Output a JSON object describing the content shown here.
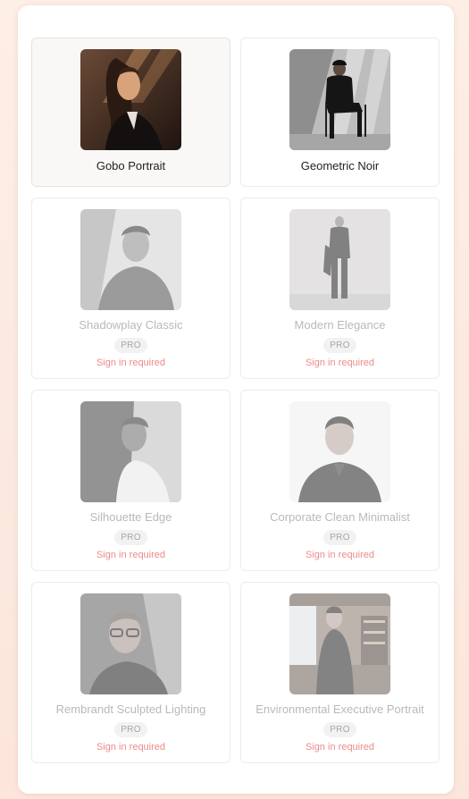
{
  "styles": [
    {
      "name": "Gobo Portrait",
      "pro": false,
      "selected": true,
      "icon": "portrait-woman-shadow-thumbnail"
    },
    {
      "name": "Geometric Noir",
      "pro": false,
      "selected": false,
      "icon": "portrait-man-chair-thumbnail"
    },
    {
      "name": "Shadowplay Classic",
      "pro": true,
      "badge": "PRO",
      "notice": "Sign in required",
      "icon": "portrait-man-sweater-thumbnail"
    },
    {
      "name": "Modern Elegance",
      "pro": true,
      "badge": "PRO",
      "notice": "Sign in required",
      "icon": "portrait-man-standing-thumbnail"
    },
    {
      "name": "Silhouette Edge",
      "pro": true,
      "badge": "PRO",
      "notice": "Sign in required",
      "icon": "portrait-man-profile-thumbnail"
    },
    {
      "name": "Corporate Clean Minimalist",
      "pro": true,
      "badge": "PRO",
      "notice": "Sign in required",
      "icon": "portrait-man-suit-thumbnail"
    },
    {
      "name": "Rembrandt Sculpted Lighting",
      "pro": true,
      "badge": "PRO",
      "notice": "Sign in required",
      "icon": "portrait-man-glasses-thumbnail"
    },
    {
      "name": "Environmental Executive Portrait",
      "pro": true,
      "badge": "PRO",
      "notice": "Sign in required",
      "icon": "portrait-man-office-thumbnail"
    }
  ],
  "colors": {
    "signin": "#ee8a8a",
    "selected_bg": "#f9f8f6"
  }
}
